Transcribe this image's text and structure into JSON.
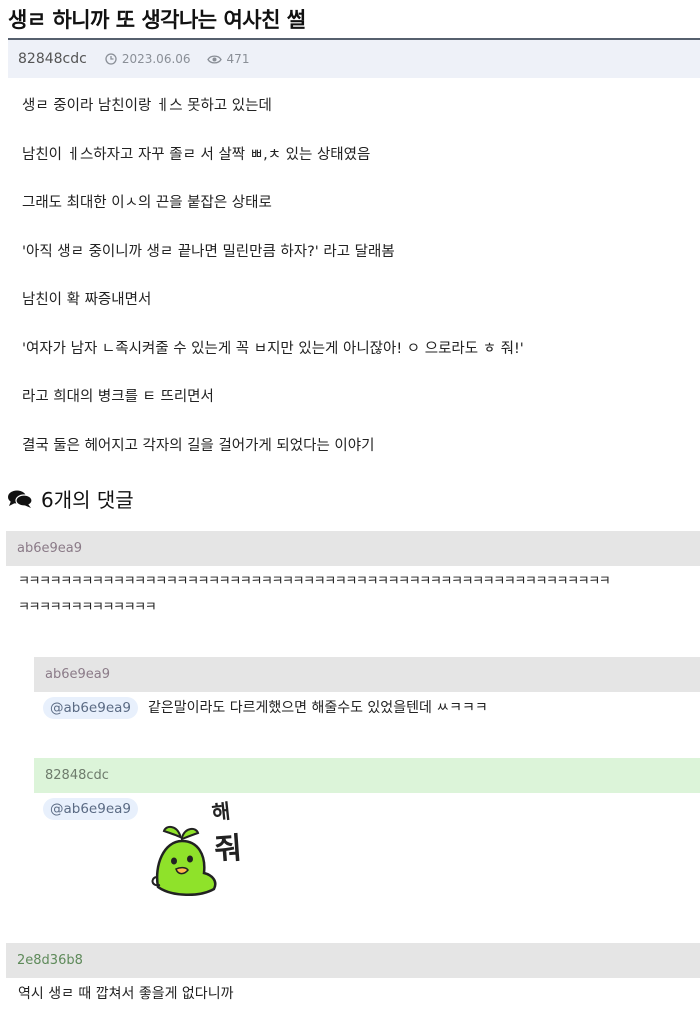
{
  "post": {
    "title": "생ㄹ 하니까 또 생각나는 여사친 썰",
    "author": "82848cdc",
    "date": "2023.06.06",
    "views": "471",
    "lines": [
      "생ㄹ 중이라 남친이랑  ㅔ스 못하고 있는데",
      "남친이  ㅔ스하자고 자꾸 졸ㄹ 서 살짝 ㅃ,ㅊ 있는 상태였음",
      "그래도 최대한 이ㅅ의 끈을 붙잡은 상태로",
      "'아직 생ㄹ 중이니까 생ㄹ  끝나면 밀린만큼 하자?' 라고 달래봄",
      "남친이 확 짜증내면서",
      "'여자가 남자 ㄴ족시켜줄 수 있는게 꼭 ㅂ지만 있는게 아니잖아! ㅇ 으로라도 ㅎ 줘!'",
      "라고 희대의 병크를 ㅌ 뜨리면서",
      "결국 둘은 헤어지고 각자의 길을 걸어가게 되었다는 이야기"
    ]
  },
  "comments_header": {
    "label": "6개의 댓글",
    "icon": "comments-icon"
  },
  "comments": [
    {
      "author": "ab6e9ea9",
      "text": "ㅋㅋㅋㅋㅋㅋㅋㅋㅋㅋㅋㅋㅋㅋㅋㅋㅋㅋㅋㅋㅋㅋㅋㅋㅋㅋㅋㅋㅋㅋㅋㅋㅋㅋㅋㅋㅋㅋㅋㅋㅋㅋㅋㅋㅋㅋㅋㅋㅋㅋㅋㅋㅋㅋㅋㅋ",
      "text2": "ㅋㅋㅋㅋㅋㅋㅋㅋㅋㅋㅋㅋㅋ"
    },
    {
      "author": "ab6e9ea9",
      "mention": "@ab6e9ea9",
      "text": "같은말이라도 다르게했으면 해줄수도 있었을텐데 ㅆㅋㅋㅋ"
    },
    {
      "author": "82848cdc",
      "mention": "@ab6e9ea9",
      "sticker": "green-bird-sticker",
      "sticker_text": "해 줘"
    },
    {
      "author": "2e8d36b8",
      "text": "역시 생ㄹ 때 깝쳐서 좋을게 없다니까"
    }
  ],
  "colors": {
    "meta_bg": "#eef1f8",
    "comment_bar_gray": "#e5e5e5",
    "comment_bar_green": "#dcf4d9",
    "mention_bg": "#e8f0fc",
    "sticker_green": "#8fe22a"
  }
}
